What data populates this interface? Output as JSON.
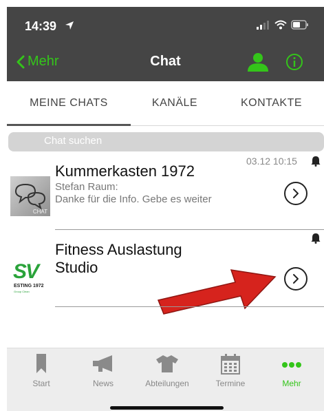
{
  "status_bar": {
    "time": "14:39"
  },
  "nav": {
    "back_label": "Mehr",
    "title": "Chat"
  },
  "tabs": [
    {
      "label": "MEINE CHATS",
      "active": true
    },
    {
      "label": "KANÄLE",
      "active": false
    },
    {
      "label": "KONTAKTE",
      "active": false
    }
  ],
  "search": {
    "placeholder": "Chat suchen"
  },
  "chats": [
    {
      "title": "Kummerkasten 1972",
      "sender": "Stefan Raum:",
      "preview": "Danke für die Info. Gebe es weiter",
      "time": "03.12 10:15",
      "thumb_label": "CHAT",
      "icon": "chat-bubbles-icon"
    },
    {
      "title_line1": "Fitness Auslastung",
      "title_line2": "Studio",
      "logo_text": "SV",
      "logo_sub": "ESTING 1972",
      "logo_tiny": "Group Clean"
    }
  ],
  "tabbar": [
    {
      "label": "Start",
      "icon": "bookmark-icon"
    },
    {
      "label": "News",
      "icon": "megaphone-icon"
    },
    {
      "label": "Abteilungen",
      "icon": "shirt-icon"
    },
    {
      "label": "Termine",
      "icon": "calendar-icon"
    },
    {
      "label": "Mehr",
      "icon": "more-dots-icon",
      "active": true
    }
  ],
  "colors": {
    "accent": "#34c51a",
    "header_bg": "#454545",
    "arrow": "#d6231d"
  }
}
